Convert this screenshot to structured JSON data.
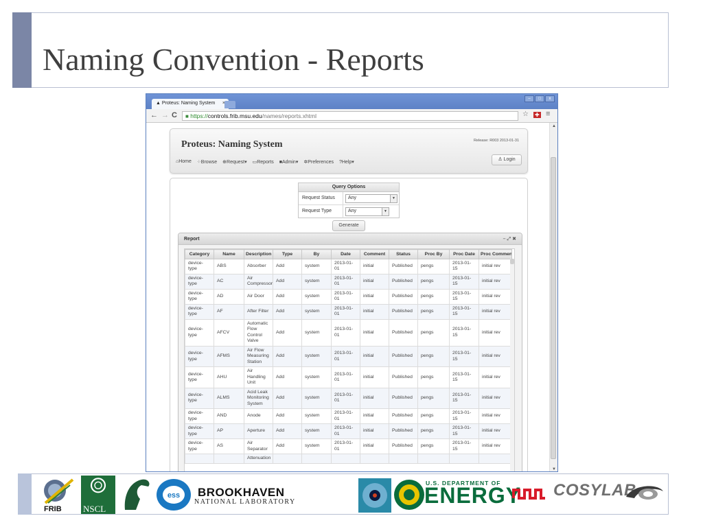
{
  "slide": {
    "title": "Naming Convention - Reports"
  },
  "browser": {
    "tab_title": "Proteus: Naming System",
    "tab_close": "×",
    "url_https": "https://",
    "url_host": "controls.frib.msu.edu",
    "url_path": "/names/reports.xhtml",
    "win_min": "–",
    "win_max": "□",
    "win_close": "x"
  },
  "app": {
    "title": "Proteus: Naming System",
    "release": "Release: R003 2013-01-31",
    "menu": {
      "home": "Home",
      "browse": "Browse",
      "request": "Request",
      "reports": "Reports",
      "admin": "Admin",
      "preferences": "Preferences",
      "help": "Help"
    },
    "login": "Login"
  },
  "query": {
    "header": "Query Options",
    "status_label": "Request Status",
    "status_value": "Any",
    "type_label": "Request Type",
    "type_value": "Any",
    "generate": "Generate"
  },
  "report": {
    "header": "Report",
    "columns": [
      "Category",
      "Name",
      "Description",
      "Type",
      "By",
      "Date",
      "Comment",
      "Status",
      "Proc By",
      "Proc Date",
      "Proc Comment"
    ],
    "rows": [
      [
        "device-type",
        "ABS",
        "Absorber",
        "Add",
        "system",
        "2013-01-01",
        "initial",
        "Published",
        "pengs",
        "2013-01-15",
        "initial rev"
      ],
      [
        "device-type",
        "AC",
        "Air Compressor",
        "Add",
        "system",
        "2013-01-01",
        "initial",
        "Published",
        "pengs",
        "2013-01-15",
        "initial rev"
      ],
      [
        "device-type",
        "AD",
        "Air Door",
        "Add",
        "system",
        "2013-01-01",
        "initial",
        "Published",
        "pengs",
        "2013-01-15",
        "initial rev"
      ],
      [
        "device-type",
        "AF",
        "After Filter",
        "Add",
        "system",
        "2013-01-01",
        "initial",
        "Published",
        "pengs",
        "2013-01-15",
        "initial rev"
      ],
      [
        "device-type",
        "AFCV",
        "Automatic Flow Control Valve",
        "Add",
        "system",
        "2013-01-01",
        "initial",
        "Published",
        "pengs",
        "2013-01-15",
        "initial rev"
      ],
      [
        "device-type",
        "AFMS",
        "Air Flow Measuring Station",
        "Add",
        "system",
        "2013-01-01",
        "initial",
        "Published",
        "pengs",
        "2013-01-15",
        "initial rev"
      ],
      [
        "device-type",
        "AHU",
        "Air Handling Unit",
        "Add",
        "system",
        "2013-01-01",
        "initial",
        "Published",
        "pengs",
        "2013-01-15",
        "initial rev"
      ],
      [
        "device-type",
        "ALMS",
        "Acid Leak Monitoring System",
        "Add",
        "system",
        "2013-01-01",
        "initial",
        "Published",
        "pengs",
        "2013-01-15",
        "initial rev"
      ],
      [
        "device-type",
        "AND",
        "Anode",
        "Add",
        "system",
        "2013-01-01",
        "initial",
        "Published",
        "pengs",
        "2013-01-15",
        "initial rev"
      ],
      [
        "device-type",
        "AP",
        "Aperture",
        "Add",
        "system",
        "2013-01-01",
        "initial",
        "Published",
        "pengs",
        "2013-01-15",
        "initial rev"
      ],
      [
        "device-type",
        "AS",
        "Air Separator",
        "Add",
        "system",
        "2013-01-01",
        "initial",
        "Published",
        "pengs",
        "2013-01-15",
        "initial rev"
      ],
      [
        "",
        "",
        "Attenuation",
        "",
        "",
        "",
        "",
        "",
        "",
        "",
        ""
      ]
    ]
  },
  "logos": {
    "frib": "FRIB",
    "nscl": "NSCL",
    "bnl_top": "BROOKHAVEN",
    "bnl_bottom": "NATIONAL LABORATORY",
    "doe_small": "U.S. DEPARTMENT OF",
    "doe_big": "ENERGY",
    "cosylab": "COSYLAB"
  }
}
